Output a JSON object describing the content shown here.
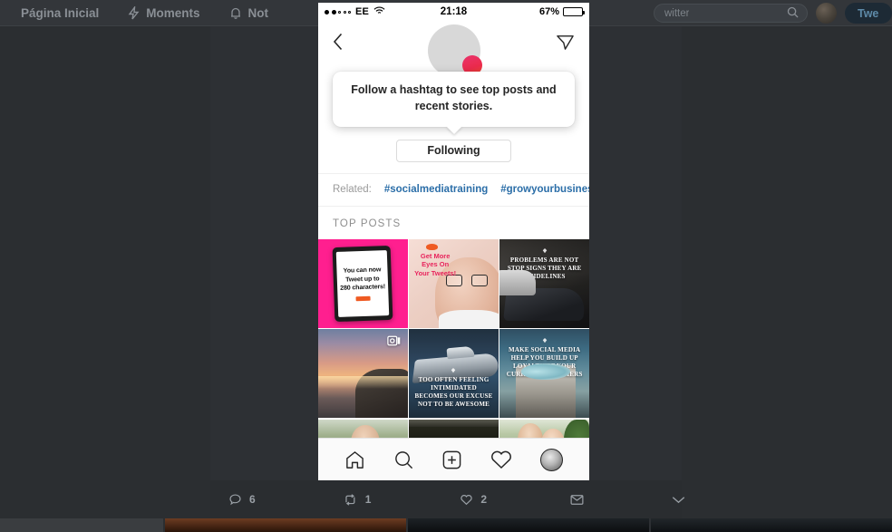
{
  "twitter": {
    "nav": [
      {
        "label": "Página Inicial",
        "icon": "home-icon"
      },
      {
        "label": "Moments",
        "icon": "lightning-icon"
      },
      {
        "label": "Not",
        "icon": "bell-icon"
      }
    ],
    "search_placeholder": "witter",
    "tweet_button": "Twe",
    "actions": {
      "reply_count": "6",
      "retweet_count": "1",
      "like_count": "2",
      "message_icon": "envelope-icon",
      "more_icon": "chevron-down-icon"
    }
  },
  "phone": {
    "status": {
      "signal_dots_filled": 2,
      "signal_dots_total": 5,
      "carrier": "EE",
      "wifi": "wifi-icon",
      "time": "21:18",
      "battery_percent": "67%",
      "battery_level": 67
    },
    "header": {
      "back_icon": "chevron-left-icon",
      "share_icon": "send-icon",
      "avatar": "hashtag-avatar"
    },
    "tooltip": {
      "text": "Follow a hashtag to see top posts and recent stories."
    },
    "follow_button": "Following",
    "related": {
      "label": "Related:",
      "tags": [
        "#socialmediatraining",
        "#growyourbusiness",
        "#"
      ]
    },
    "top_posts_heading": "TOP POSTS",
    "posts": [
      {
        "id": "post-1",
        "caption": "You can now Tweet up to 280 characters!",
        "style": "p1",
        "caption_pos": "tablet"
      },
      {
        "id": "post-2",
        "caption": "Get More Eyes On Your Tweets!",
        "style": "p2",
        "caption_pos": "left"
      },
      {
        "id": "post-3",
        "caption": "PROBLEMS ARE NOT STOP SIGNS THEY ARE GUIDELINES",
        "style": "p3",
        "caption_pos": "top"
      },
      {
        "id": "post-4",
        "caption": "",
        "style": "p4",
        "badge": "carousel-video-icon"
      },
      {
        "id": "post-5",
        "caption": "TOO OFTEN FEELING INTIMIDATED BECOMES OUR EXCUSE NOT TO BE AWESOME",
        "style": "p5",
        "caption_pos": "bottom"
      },
      {
        "id": "post-6",
        "caption": "MAKE SOCIAL MEDIA HELP YOU BUILD UP LOYALTY OF YOUR CURRENT CUSTOMERS",
        "style": "p6",
        "caption_pos": "top"
      },
      {
        "id": "post-7",
        "caption": "",
        "style": "p7"
      },
      {
        "id": "post-8",
        "caption": "",
        "style": "p8"
      },
      {
        "id": "post-9",
        "caption": "",
        "style": "p9"
      }
    ],
    "nav": [
      {
        "name": "home",
        "icon": "home-icon"
      },
      {
        "name": "search",
        "icon": "search-icon"
      },
      {
        "name": "add",
        "icon": "plus-box-icon"
      },
      {
        "name": "activity",
        "icon": "heart-icon"
      },
      {
        "name": "profile",
        "icon": "profile-avatar-icon"
      }
    ]
  },
  "colors": {
    "accent_pink": "#ff1f8f",
    "link_blue": "#2b6ea8",
    "ig_text": "#262626",
    "twitter_dark": "#2a2d30"
  }
}
